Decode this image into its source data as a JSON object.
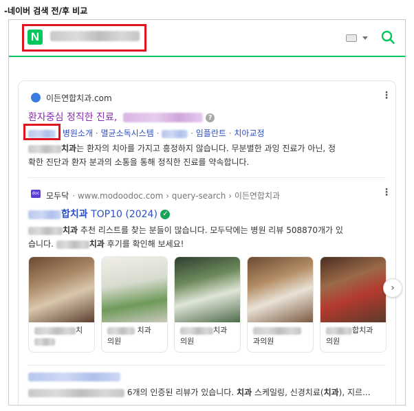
{
  "caption": "-네이버 검색 전/후 비교",
  "search": {
    "logo_letter": "N",
    "brand_color": "#03c75a"
  },
  "result1": {
    "site_name": "이든연합치과.com",
    "title": "환자중심 정직한 진료,",
    "links": [
      "병원소개",
      "멸균소독시스템",
      "임플란트",
      "치아교정"
    ],
    "separator": "·",
    "desc_bold": "치과",
    "desc_line1": "는 환자의 치아를 가지고 흥정하지 않습니다. 무분별한 과잉 진료가 아닌, 정",
    "desc_line2": "확한 진단과 환자 분과의 소통을 통해 정직한 진료를 약속합니다."
  },
  "result2": {
    "site_name": "모두닥",
    "breadcrumb": "· www.modoodoc.com › query-search › 이든연합치과",
    "title_bold": "합치과",
    "title_rest": "TOP10 (2024)",
    "desc_bold1": "치과",
    "desc_line1": " 추천 리스트를 찾는 분들이 많습니다. 모두닥에는 병원 리뷰 508870개가 있",
    "desc_line2_a": "습니다.",
    "desc_bold2": "치과",
    "desc_line2_b": " 후기를 확인해 보세요!",
    "images": [
      {
        "label_a": "치",
        "label_b": ""
      },
      {
        "label_a": "치과",
        "label_b": "의원"
      },
      {
        "label_a": "치과",
        "label_b": "의원"
      },
      {
        "label_a": "",
        "label_b": "과의원"
      },
      {
        "label_a": "합치과",
        "label_b": "의원"
      }
    ]
  },
  "result3": {
    "text_a": "6개의 인증된 리뷰가 있습니다.",
    "text_bold1": "치과",
    "text_b": " 스케일링, 신경치료(",
    "text_bold2": "치과",
    "text_c": "), 지르..."
  }
}
